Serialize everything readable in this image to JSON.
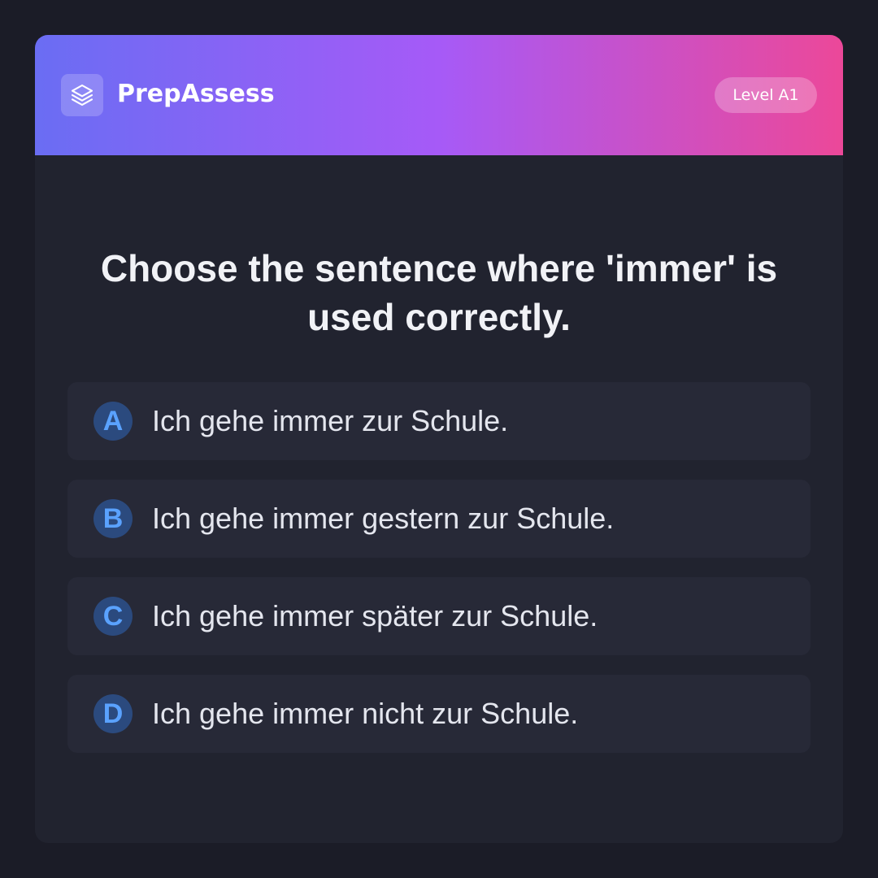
{
  "header": {
    "logo_icon": "layers-icon",
    "brand": "PrepAssess",
    "level_badge": "Level A1"
  },
  "quiz": {
    "question": "Choose the sentence where 'immer' is used correctly.",
    "options": [
      {
        "letter": "A",
        "text": "Ich gehe immer zur Schule."
      },
      {
        "letter": "B",
        "text": "Ich gehe immer gestern zur Schule."
      },
      {
        "letter": "C",
        "text": "Ich gehe immer später zur Schule."
      },
      {
        "letter": "D",
        "text": "Ich gehe immer nicht zur Schule."
      }
    ]
  },
  "colors": {
    "background": "#1b1c27",
    "card": "#21232f",
    "option_background": "#272937",
    "gradient_start": "#6a6df3",
    "gradient_mid": "#a65af7",
    "gradient_end": "#ec4899",
    "letter_circle": "#2b4a7e",
    "letter_text": "#5aa2ff"
  }
}
